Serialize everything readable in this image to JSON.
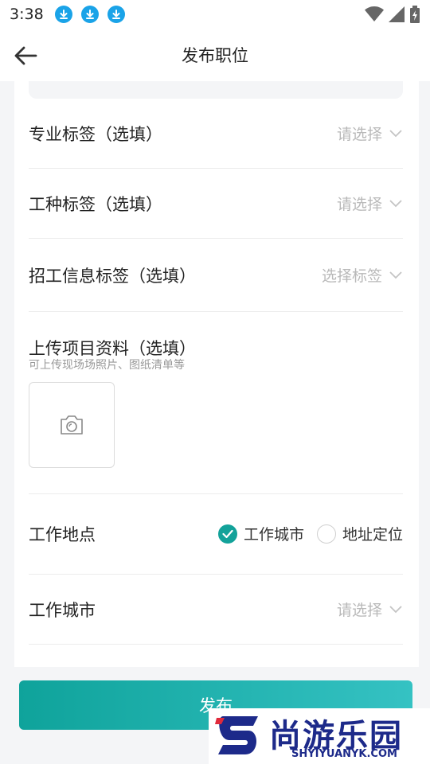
{
  "status_bar": {
    "time": "3:38",
    "download_icons": 3
  },
  "app_bar": {
    "title": "发布职位",
    "back_icon": "arrow-left-icon"
  },
  "fields": {
    "major_tag": {
      "label": "专业标签（选填）",
      "placeholder": "请选择"
    },
    "work_type_tag": {
      "label": "工种标签（选填）",
      "placeholder": "请选择"
    },
    "recruit_info_tag": {
      "label": "招工信息标签（选填）",
      "placeholder": "选择标签"
    },
    "upload": {
      "label": "上传项目资料（选填）",
      "hint": "可上传现场场照片、图纸清单等",
      "icon": "camera-icon"
    },
    "work_location": {
      "label": "工作地点",
      "option_city": "工作城市",
      "option_address": "地址定位",
      "selected": "工作城市"
    },
    "work_city": {
      "label": "工作城市",
      "placeholder": "请选择"
    }
  },
  "publish_button": {
    "label": "发布"
  },
  "watermark": {
    "title": "尚游乐园",
    "url": "SHYIYUANYK.COM"
  },
  "colors": {
    "accent": "#13a29a",
    "download_blue": "#1aa3e8",
    "placeholder": "#b9b9b9"
  }
}
